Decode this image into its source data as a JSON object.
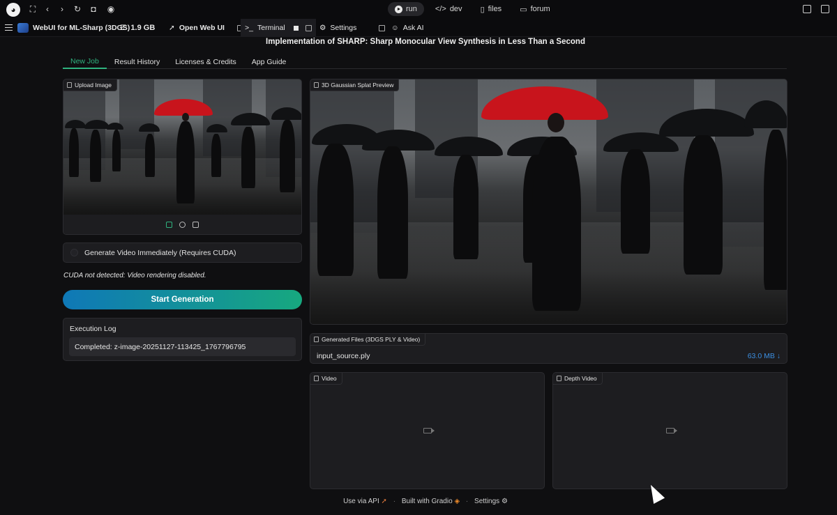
{
  "topbar": {
    "tabs": [
      {
        "label": "run",
        "icon": "play-circle-icon"
      },
      {
        "label": "dev",
        "icon": "code-icon"
      },
      {
        "label": "files",
        "icon": "file-icon"
      },
      {
        "label": "forum",
        "icon": "chat-icon"
      }
    ]
  },
  "toolbar": {
    "app_name": "WebUI for ML-Sharp (3DGS)",
    "storage": "1.9 GB",
    "open_webui": "Open Web UI",
    "terminal": "Terminal",
    "settings": "Settings",
    "ask_ai": "Ask AI"
  },
  "page": {
    "heading": "Implementation of SHARP: Sharp Monocular View Synthesis in Less Than a Second",
    "tabs": [
      "New Job",
      "Result History",
      "Licenses & Credits",
      "App Guide"
    ]
  },
  "upload": {
    "label": "Upload Image"
  },
  "preview": {
    "label": "3D Gaussian Splat Preview"
  },
  "options": {
    "generate_video": "Generate Video Immediately (Requires CUDA)",
    "cuda_note": "CUDA not detected: Video rendering disabled.",
    "start": "Start Generation"
  },
  "log": {
    "title": "Execution Log",
    "value": "Completed: z-image-20251127-113425_1767796795"
  },
  "files": {
    "label": "Generated Files (3DGS PLY & Video)",
    "file_name": "input_source.ply",
    "file_size": "63.0 MB ↓"
  },
  "video": {
    "label": "Video"
  },
  "depth_video": {
    "label": "Depth Video"
  },
  "footer": {
    "api": "Use via API",
    "built": "Built with Gradio",
    "settings": "Settings"
  },
  "colors": {
    "accent": "#2fb37f",
    "start_gradient_from": "#0f78b7",
    "start_gradient_to": "#17a87f",
    "file_size": "#3b8ee0",
    "umbrella": "#c8141c"
  }
}
